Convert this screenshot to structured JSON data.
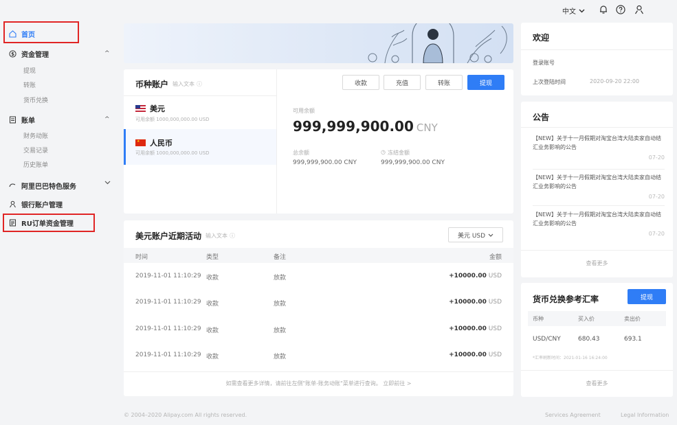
{
  "topbar": {
    "language": "中文"
  },
  "sidebar": {
    "home": "首页",
    "funds": {
      "label": "资金管理",
      "items": [
        "提现",
        "转账",
        "货币兑换"
      ]
    },
    "bills": {
      "label": "账单",
      "items": [
        "财务动账",
        "交易记录",
        "历史账单"
      ]
    },
    "alibaba": "阿里巴巴特色服务",
    "bank": "银行账户管理",
    "ru_orders": "RU订单资金管理"
  },
  "currency_account": {
    "title": "币种账户",
    "hint": "输入文本",
    "accounts": [
      {
        "name": "美元",
        "available": "可用余额 1000,000,000.00 USD"
      },
      {
        "name": "人民币",
        "available": "可用余额 1000,000,000.00 USD"
      }
    ],
    "buttons": [
      "收款",
      "充值",
      "转账",
      "提现"
    ],
    "available_label": "可用余额",
    "available_amount": "999,999,900.00",
    "available_currency": "CNY",
    "total_label": "总余额",
    "total_value": "999,999,900.00 CNY",
    "frozen_label": "冻结金额",
    "frozen_value": "999,999,900.00 CNY"
  },
  "activity": {
    "title": "美元账户近期活动",
    "hint": "输入文本",
    "currency_select": "美元 USD",
    "columns": [
      "时间",
      "类型",
      "备注",
      "金额"
    ],
    "rows": [
      {
        "time": "2019-11-01 11:10:29",
        "type": "收款",
        "note": "放款",
        "amount": "+10000.00",
        "currency": "USD"
      },
      {
        "time": "2019-11-01 11:10:29",
        "type": "收款",
        "note": "放款",
        "amount": "+10000.00",
        "currency": "USD"
      },
      {
        "time": "2019-11-01 11:10:29",
        "type": "收款",
        "note": "放款",
        "amount": "+10000.00",
        "currency": "USD"
      },
      {
        "time": "2019-11-01 11:10:29",
        "type": "收款",
        "note": "放款",
        "amount": "+10000.00",
        "currency": "USD"
      }
    ],
    "footer_note": "如需查看更多详情，请前往左侧\"账单-账务动账\"菜单进行查询。 立即前往 >"
  },
  "welcome": {
    "title": "欢迎",
    "login_label": "登录账号",
    "last_login_label": "上次登陆时间",
    "last_login_value": "2020-09-20 22:00"
  },
  "announcements": {
    "title": "公告",
    "items": [
      {
        "text": "【NEW】关于十一月假期对淘宝台湾大陆卖家自动结汇业务影响的公告",
        "date": "07-20"
      },
      {
        "text": "【NEW】关于十一月假期对淘宝台湾大陆卖家自动结汇业务影响的公告",
        "date": "07-20"
      },
      {
        "text": "【NEW】关于十一月假期对淘宝台湾大陆卖家自动结汇业务影响的公告",
        "date": "07-20"
      }
    ],
    "more": "查看更多"
  },
  "exchange": {
    "title": "货币兑换参考汇率",
    "button": "提现",
    "columns": [
      "币种",
      "买入价",
      "卖出价"
    ],
    "row": {
      "pair": "USD/CNY",
      "buy": "680.43",
      "sell": "693.1"
    },
    "update_time": "*汇率刷新时间：2021-01-16 16:24:00",
    "more": "查看更多"
  },
  "footer": {
    "copyright": "© 2004–2020 Alipay.com All rights reserved.",
    "services": "Services Agreement",
    "legal": "Legal Information"
  },
  "colors": {
    "primary": "#2f7df6",
    "highlight": "#e02424"
  }
}
